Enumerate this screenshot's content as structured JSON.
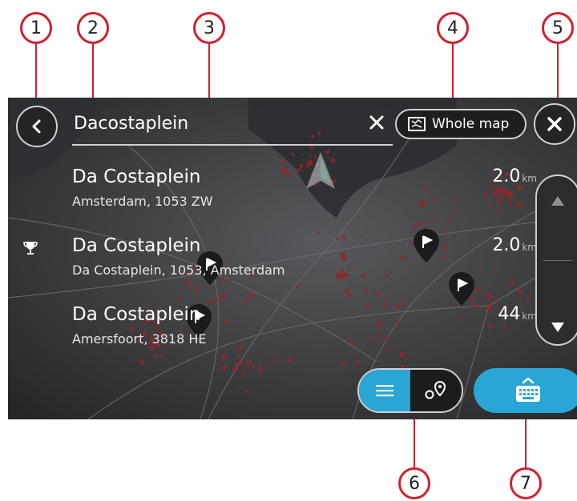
{
  "callouts": [
    "1",
    "2",
    "3",
    "4",
    "5",
    "6",
    "7"
  ],
  "search": {
    "query": "Dacostaplein"
  },
  "whole_map": {
    "label": "Whole map"
  },
  "results": [
    {
      "name": "Da Costaplein",
      "address": "Amsterdam, 1053 ZW",
      "distance": "2.0",
      "unit": "km",
      "favorite": false
    },
    {
      "name": "Da Costaplein",
      "address": "Da Costaplein, 1053, Amsterdam",
      "distance": "2.0",
      "unit": "km",
      "favorite": true
    },
    {
      "name": "Da Costaplein",
      "address": "Amersfoort, 3818 HE",
      "distance": "44",
      "unit": "km",
      "favorite": false
    }
  ],
  "icons": {
    "back": "chevron-left-icon",
    "clear": "close-icon",
    "whole_map": "map-icon",
    "close": "close-icon",
    "favorite": "trophy-icon",
    "scroll_up": "triangle-up-icon",
    "scroll_down": "triangle-down-icon",
    "list_view": "list-icon",
    "map_view": "route-points-icon",
    "keyboard": "keyboard-icon"
  },
  "colors": {
    "accent": "#29a6d6",
    "callout": "#d0202e",
    "button_bg": "#242426",
    "map_bg": "#3a3a3c"
  }
}
